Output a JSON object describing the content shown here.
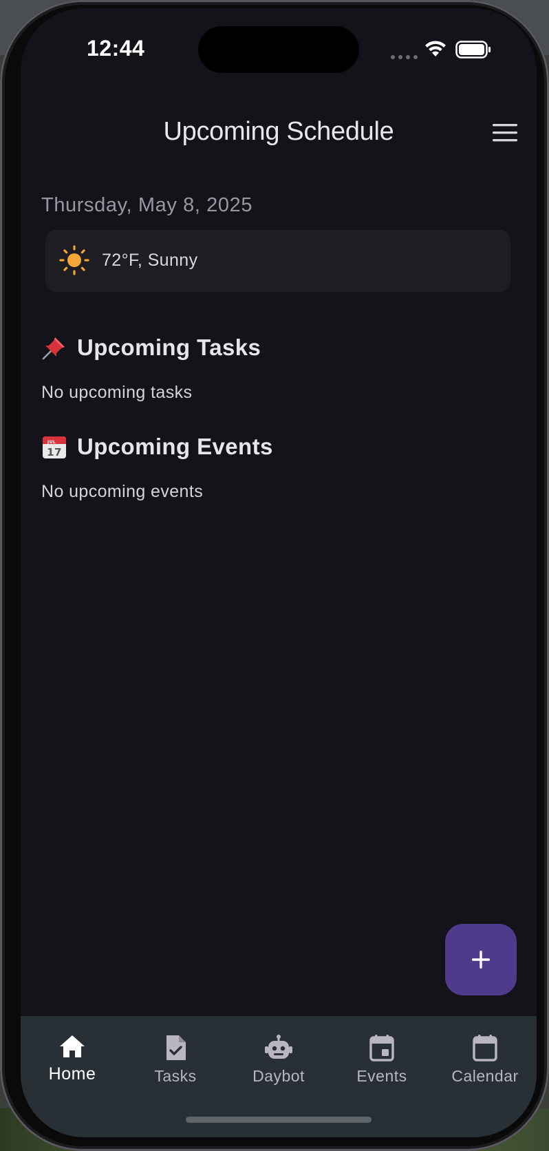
{
  "status_bar": {
    "time": "12:44"
  },
  "header": {
    "title": "Upcoming Schedule",
    "menu_icon": "hamburger-menu-icon"
  },
  "date": "Thursday, May 8, 2025",
  "weather": {
    "icon": "sun-icon",
    "text": "72°F, Sunny"
  },
  "sections": {
    "tasks": {
      "icon": "pushpin-icon",
      "title": "Upcoming Tasks",
      "empty_text": "No upcoming tasks"
    },
    "events": {
      "icon": "calendar-icon",
      "title": "Upcoming Events",
      "empty_text": "No upcoming events",
      "icon_month": "JUL",
      "icon_day": "17"
    }
  },
  "fab": {
    "icon": "plus-icon"
  },
  "bottom_nav": {
    "items": [
      {
        "label": "Home",
        "icon": "home-icon",
        "active": true
      },
      {
        "label": "Tasks",
        "icon": "task-file-icon",
        "active": false
      },
      {
        "label": "Daybot",
        "icon": "robot-icon",
        "active": false
      },
      {
        "label": "Events",
        "icon": "event-icon",
        "active": false
      },
      {
        "label": "Calendar",
        "icon": "calendar-blank-icon",
        "active": false
      }
    ]
  },
  "colors": {
    "background": "#15131a",
    "card": "#1e1d22",
    "fab": "#4e3b8c",
    "nav_bar": "#283036",
    "sun": "#f4a637"
  }
}
